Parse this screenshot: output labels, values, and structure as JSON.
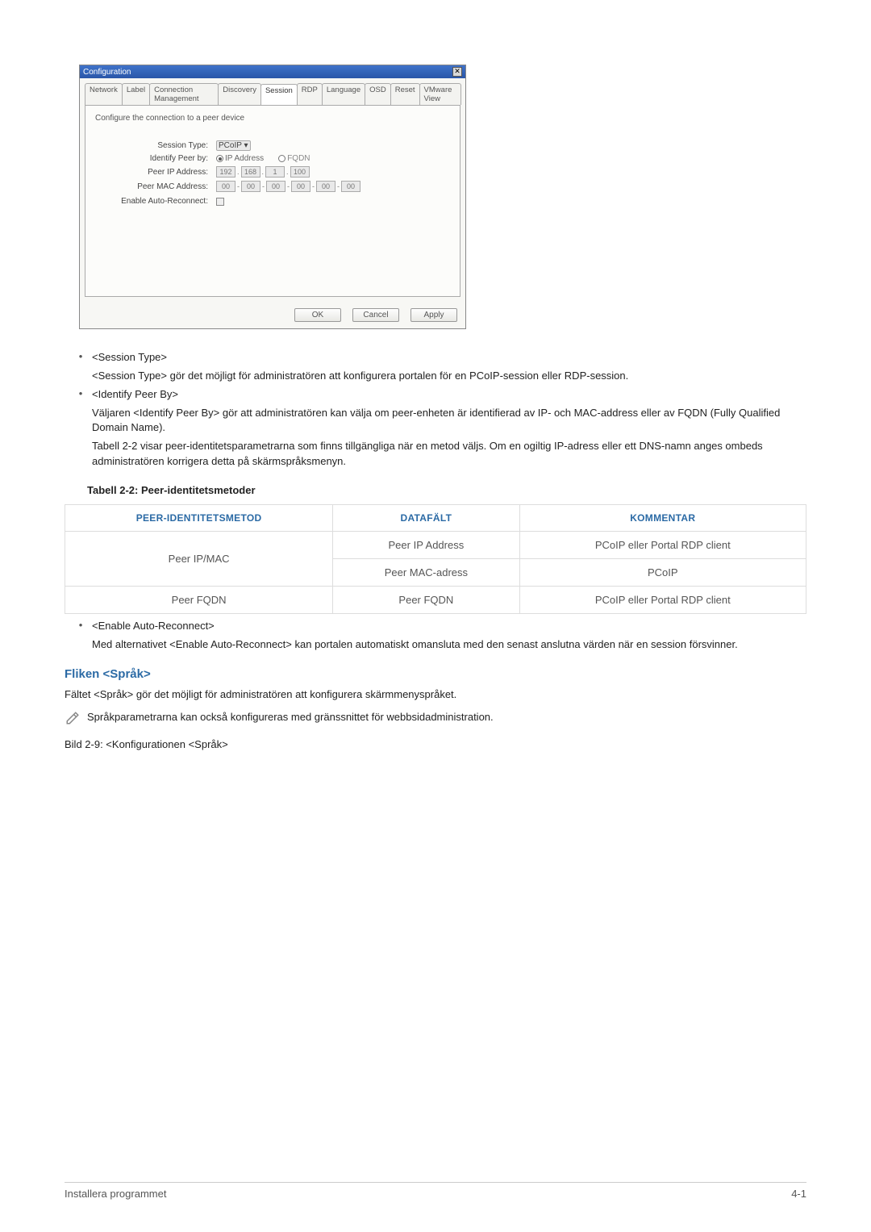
{
  "dialog": {
    "title": "Configuration",
    "tabs": [
      "Network",
      "Label",
      "Connection Management",
      "Discovery",
      "Session",
      "RDP",
      "Language",
      "OSD",
      "Reset",
      "VMware View"
    ],
    "active_tab_index": 4,
    "description": "Configure the connection to a peer device",
    "fields": {
      "session_type": {
        "label": "Session Type:",
        "value": "PCoIP"
      },
      "identify_peer": {
        "label": "Identify Peer by:",
        "opt_ip": "IP Address",
        "opt_fqdn": "FQDN"
      },
      "peer_ip": {
        "label": "Peer IP Address:",
        "o1": "192",
        "o2": "168",
        "o3": "1",
        "o4": "100"
      },
      "peer_mac": {
        "label": "Peer MAC Address:",
        "m1": "00",
        "m2": "00",
        "m3": "00",
        "m4": "00",
        "m5": "00",
        "m6": "00"
      },
      "auto_reconnect": {
        "label": "Enable Auto-Reconnect:"
      }
    },
    "buttons": {
      "ok": "OK",
      "cancel": "Cancel",
      "apply": "Apply"
    }
  },
  "bullets": {
    "b1_title": "<Session Type>",
    "b1_body": "<Session Type> gör det möjligt för administratören att konfigurera portalen för en PCoIP-session eller RDP-session.",
    "b2_title": "<Identify Peer By>",
    "b2_body1": "Väljaren <Identify Peer By> gör att administratören kan välja om peer-enheten är identifierad av IP- och MAC-address eller av FQDN (Fully Qualified Domain Name).",
    "b2_body2": "Tabell 2-2 visar peer-identitetsparametrarna som finns tillgängliga när en metod väljs. Om en ogiltig IP-adress eller ett DNS-namn anges ombeds administratören korrigera detta på skärmspråksmenyn."
  },
  "table_caption": "Tabell 2-2: Peer-identitetsmetoder",
  "table": {
    "headers": {
      "h1": "PEER-IDENTITETSMETOD",
      "h2": "DATAFÄLT",
      "h3": "KOMMENTAR"
    },
    "rows": [
      {
        "c1": "Peer IP/MAC",
        "c2": "Peer IP Address",
        "c3": "PCoIP eller Portal RDP client"
      },
      {
        "c1_rowspan": true,
        "c2": "Peer MAC-adress",
        "c3": "PCoIP"
      },
      {
        "c1": "Peer FQDN",
        "c2": "Peer FQDN",
        "c3": "PCoIP eller Portal RDP client"
      }
    ]
  },
  "after_table": {
    "b3_title": "<Enable Auto-Reconnect>",
    "b3_body": "Med alternativet <Enable Auto-Reconnect> kan portalen automatiskt omansluta med den senast anslutna värden när en session försvinner."
  },
  "section_heading": "Fliken <Språk>",
  "section_body": "Fältet <Språk> gör det möjligt för administratören att konfigurera skärmmenyspråket.",
  "note_text": "Språkparametrarna kan också konfigureras med gränssnittet för webbsidadministration.",
  "fig_caption": "Bild 2-9: <Konfigurationen <Språk>",
  "footer": {
    "left": "Installera programmet",
    "right": "4-1"
  }
}
